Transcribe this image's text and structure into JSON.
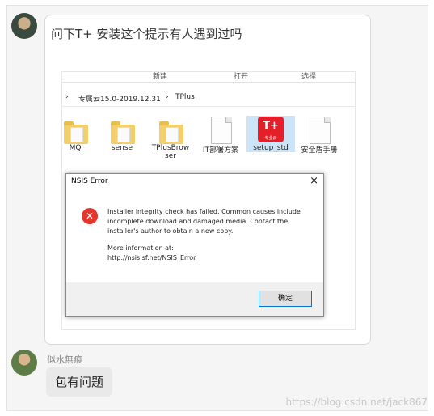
{
  "question": {
    "text": "问下T+ 安装这个提示有人遇到过吗"
  },
  "explorer": {
    "toolbar": [
      "新建",
      "打开",
      "选择"
    ],
    "breadcrumb": [
      "专属云15.0-2019.12.31",
      "TPlus"
    ],
    "items": [
      {
        "label": "MQ",
        "type": "folder"
      },
      {
        "label": "sense",
        "type": "folder"
      },
      {
        "label": "TPlusBrowser",
        "type": "folder"
      },
      {
        "label": "IT部署方案",
        "type": "file"
      },
      {
        "label": "setup_std",
        "type": "app"
      },
      {
        "label": "安全盾手册",
        "type": "file"
      }
    ],
    "app_logo": {
      "main": "T+",
      "sub": "专业云"
    }
  },
  "dialog": {
    "title": "NSIS Error",
    "close": "×",
    "message": "Installer integrity check has failed. Common causes include incomplete download and damaged media. Contact the installer's author to obtain a new copy.",
    "more_info": "More information at:",
    "link": "http://nsis.sf.net/NSIS_Error",
    "ok_button": "确定",
    "icon_glyph": "✕"
  },
  "reply": {
    "username": "似水無痕",
    "text": "包有问题"
  },
  "watermark": "https://blog.csdn.net/jack867",
  "colors": {
    "error_red": "#e3362d",
    "button_border": "#0078d7",
    "bubble_grey": "#e9e9e9"
  }
}
